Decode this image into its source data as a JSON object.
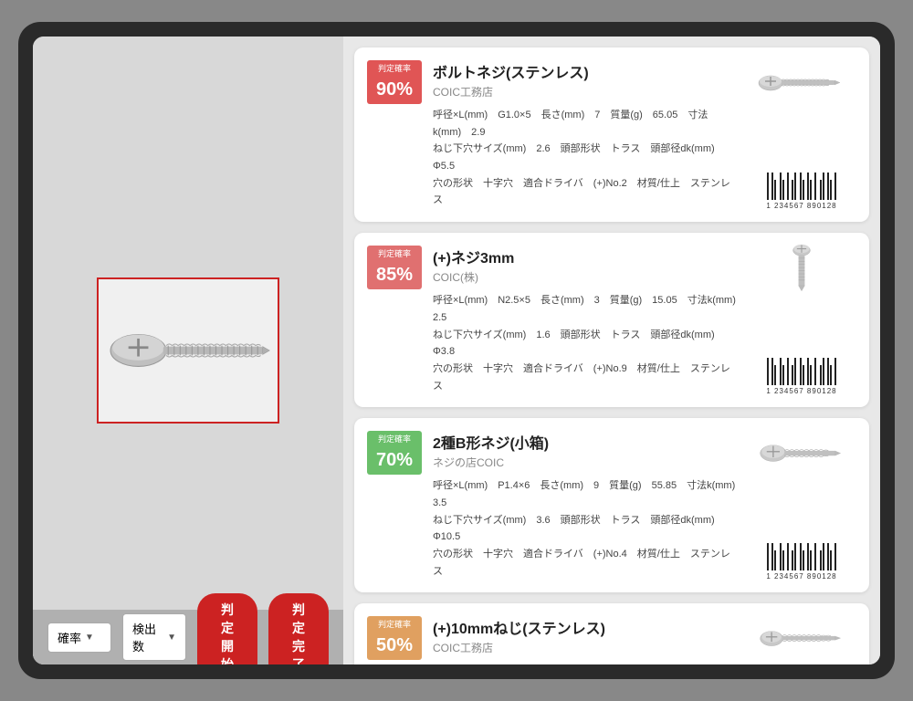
{
  "toolbar": {
    "filter_label": "確率",
    "filter_arrow": "▼",
    "count_label": "検出数",
    "count_arrow": "▼",
    "start_button": "判定開始",
    "complete_button": "判定完了"
  },
  "results": [
    {
      "id": "result-1",
      "confidence_label": "判定確率",
      "confidence": "90%",
      "confidence_class": "badge-90",
      "title": "ボルトネジ(ステンレス)",
      "shop": "COIC工務店",
      "specs": [
        "呼径×L(mm)  G1.0×5  長さ(mm)  7  質量(g)  65.05  寸法k(mm)  2.9",
        "ねじ下穴サイズ(mm)  2.6  頭部形状  トラス  頭部径dk(mm)  Φ5.5",
        "穴の形状  十字穴  適合ドライバ  (+)No.2  材質/仕上  ステンレス"
      ],
      "barcode_number": "1 234567 890128"
    },
    {
      "id": "result-2",
      "confidence_label": "判定確率",
      "confidence": "85%",
      "confidence_class": "badge-85",
      "title": "(+)ネジ3mm",
      "shop": "COIC(株)",
      "specs": [
        "呼径×L(mm)  N2.5×5  長さ(mm)  3  質量(g)  15.05  寸法k(mm)  2.5",
        "ねじ下穴サイズ(mm)  1.6  頭部形状  トラス  頭部径dk(mm)  Φ3.8",
        "穴の形状  十字穴  適合ドライバ  (+)No.9  材質/仕上  ステンレス"
      ],
      "barcode_number": "1 234567 890128"
    },
    {
      "id": "result-3",
      "confidence_label": "判定確率",
      "confidence": "70%",
      "confidence_class": "badge-70",
      "title": "2種B形ネジ(小箱)",
      "shop": "ネジの店COIC",
      "specs": [
        "呼径×L(mm)  P1.4×6  長さ(mm)  9  質量(g)  55.85  寸法k(mm)  3.5",
        "ねじ下穴サイズ(mm)  3.6  頭部形状  トラス  頭部径dk(mm)  Φ10.5",
        "穴の形状  十字穴  適合ドライバ  (+)No.4  材質/仕上  ステンレス"
      ],
      "barcode_number": "1 234567 890128"
    },
    {
      "id": "result-4",
      "confidence_label": "判定確率",
      "confidence": "50%",
      "confidence_class": "badge-50",
      "title": "(+)10mmねじ(ステンレス)",
      "shop": "COIC工務店",
      "specs": [],
      "barcode_number": ""
    }
  ]
}
